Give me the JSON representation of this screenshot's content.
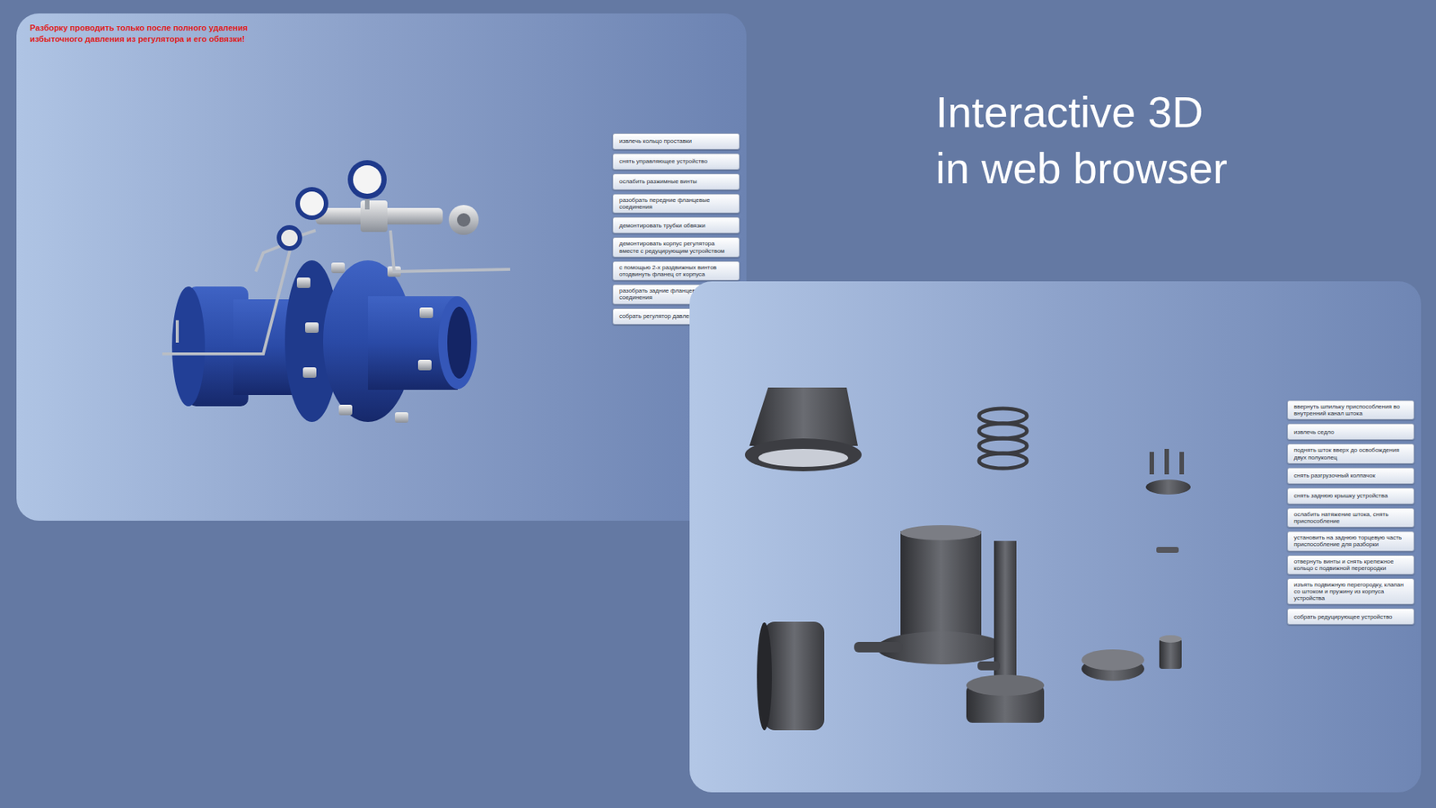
{
  "headline": [
    "Interactive 3D",
    "in web browser"
  ],
  "left_panel": {
    "warning": [
      "Разборку проводить только после полного удаления",
      "избыточного давления из регулятора и его обвязки!"
    ],
    "buttons": [
      "извлечь кольцо проставки",
      "снять управляющее устройство",
      "ослабить разжимные винты",
      "разобрать передние фланцевые соединения",
      "демонтировать трубки обвязки",
      "демонтировать корпус регулятора вместе с редуцирующим устройством",
      "с помощью 2-х раздвижных винтов отодвинуть фланец от корпуса",
      "разобрать задние фланцевые соединения",
      "собрать регулятор давления"
    ]
  },
  "right_panel": {
    "buttons": [
      "ввернуть шпильку приспособления во внутренний канал штока",
      "извлечь седло",
      "поднять шток вверх до освобождения двух полуколец",
      "снять разгрузочный колпачок",
      "снять заднюю крышку устройства",
      "ослабить натяжение штока, снять приспособление",
      "установить на заднюю торцевую часть приспособление для разборки",
      "отвернуть винты и снять крепежное кольцо с подвижной перегородки",
      "изъять подвижную перегородку, клапан со штоком и пружину из корпуса устройства",
      "собрать редуцирующее устройство"
    ]
  }
}
